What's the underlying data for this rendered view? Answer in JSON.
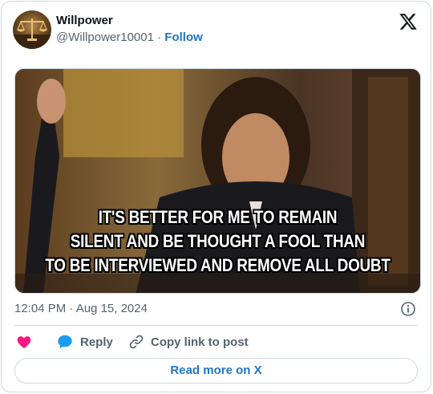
{
  "author": {
    "name": "Willpower",
    "handle": "@Willpower10001",
    "separator": "·",
    "follow_label": "Follow"
  },
  "media": {
    "caption_lines": [
      "IT'S BETTER FOR ME TO REMAIN",
      "SILENT AND BE THOUGHT A FOOL THAN",
      "TO BE INTERVIEWED AND REMOVE ALL DOUBT"
    ]
  },
  "timestamp": "12:04 PM · Aug 15, 2024",
  "actions": {
    "like_label": "",
    "reply_label": "Reply",
    "copy_label": "Copy link to post"
  },
  "read_more_label": "Read more on X",
  "icons": {
    "platform": "x-logo-icon",
    "info": "info-icon",
    "like": "heart-icon",
    "reply": "speech-bubble-icon",
    "copy": "link-icon"
  },
  "colors": {
    "link_blue": "#1d76c4",
    "heart_pink": "#f91880",
    "reply_blue": "#1d9bf0",
    "muted_gray": "#536471",
    "border": "#cfd9de"
  }
}
